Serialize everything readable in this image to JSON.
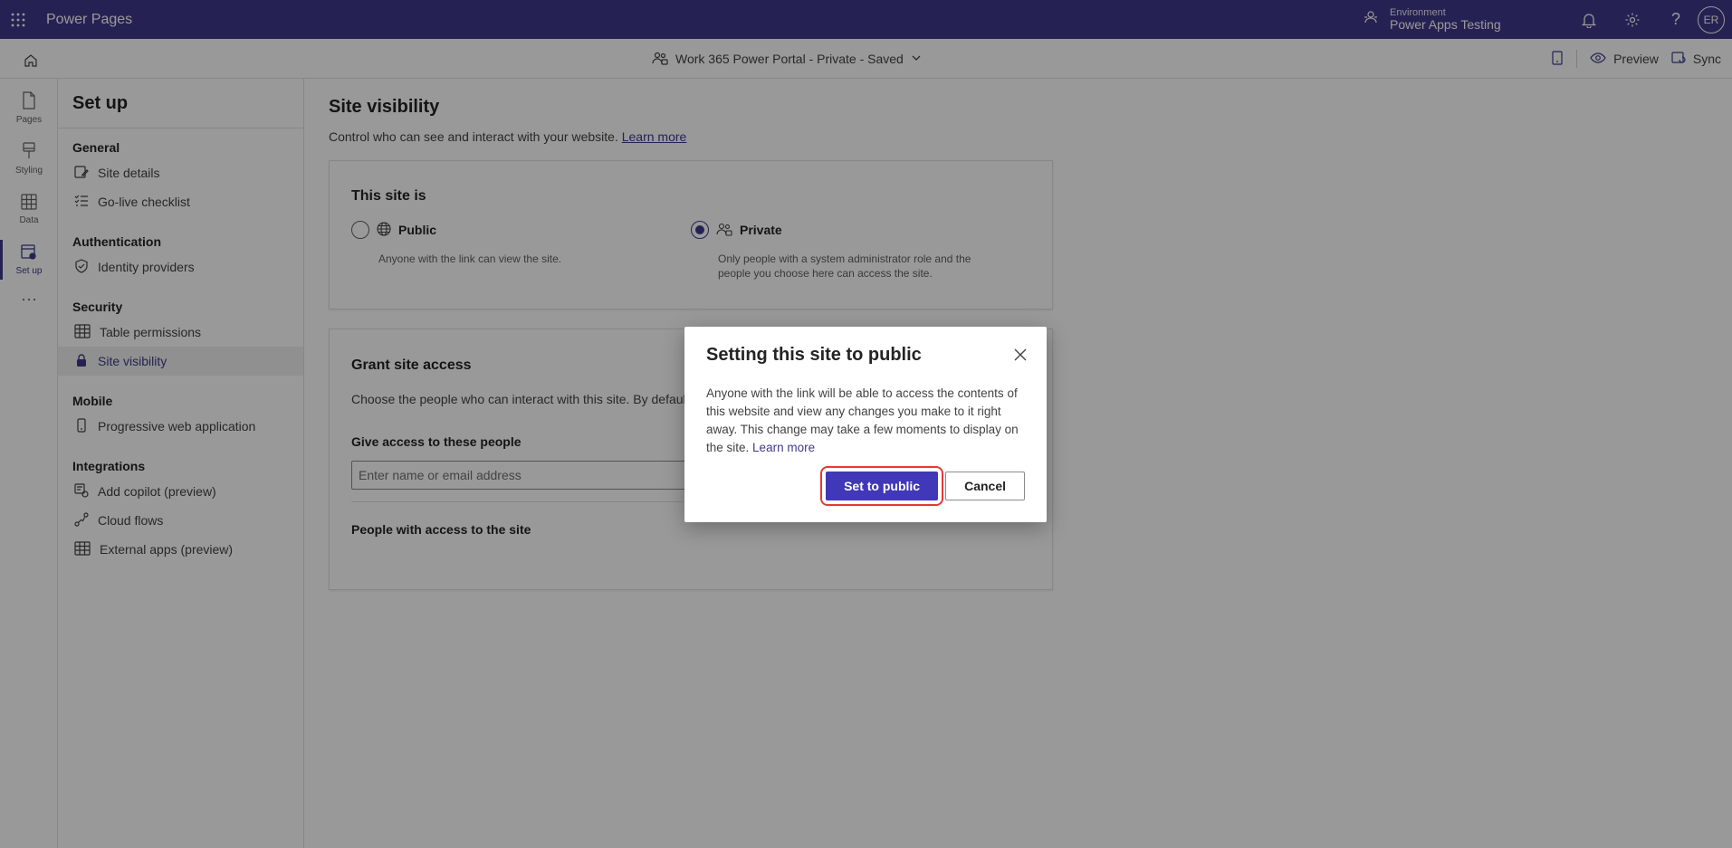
{
  "app": {
    "title": "Power Pages"
  },
  "environment": {
    "label": "Environment",
    "name": "Power Apps Testing"
  },
  "user": {
    "initials": "ER"
  },
  "command_bar": {
    "site_title": "Work 365 Power Portal - Private - Saved",
    "preview_label": "Preview",
    "sync_label": "Sync"
  },
  "rail": {
    "items": [
      {
        "label": "Pages",
        "icon": "page-icon"
      },
      {
        "label": "Styling",
        "icon": "paintbrush-icon"
      },
      {
        "label": "Data",
        "icon": "table-icon"
      },
      {
        "label": "Set up",
        "icon": "setup-icon"
      }
    ],
    "more": "···"
  },
  "setup_nav": {
    "title": "Set up",
    "sections": {
      "general": "General",
      "authentication": "Authentication",
      "security": "Security",
      "mobile": "Mobile",
      "integrations": "Integrations"
    },
    "items": {
      "site_details": "Site details",
      "go_live": "Go-live checklist",
      "identity": "Identity providers",
      "table_permissions": "Table permissions",
      "site_visibility": "Site visibility",
      "pwa": "Progressive web application",
      "copilot": "Add copilot (preview)",
      "cloud_flows": "Cloud flows",
      "external_apps": "External apps (preview)"
    }
  },
  "main": {
    "heading": "Site visibility",
    "subtitle": "Control who can see and interact with your website.",
    "learn_more": "Learn more",
    "visibility_card": {
      "heading": "This site is",
      "public_label": "Public",
      "public_desc": "Anyone with the link can view the site.",
      "private_label": "Private",
      "private_desc_1": "Only people with a system administrator role and the",
      "private_desc_2": "people you choose here can access the site.",
      "selected": "Private"
    },
    "grant_card": {
      "heading": "Grant site access",
      "description": "Choose the people who can interact with this site. By defaul",
      "give_access_label": "Give access to these people",
      "input_placeholder": "Enter name or email address",
      "people_label": "People with access to the site"
    }
  },
  "dialog": {
    "title": "Setting this site to public",
    "body": "Anyone with the link will be able to access the contents of this website and view any changes you make to it right away. This change may take a few moments to display on the site.",
    "learn_more": "Learn more",
    "primary_label": "Set to public",
    "cancel_label": "Cancel"
  },
  "colors": {
    "brand": "#3f3a8a",
    "primary_button": "#4038b8",
    "highlight": "#e53935"
  }
}
